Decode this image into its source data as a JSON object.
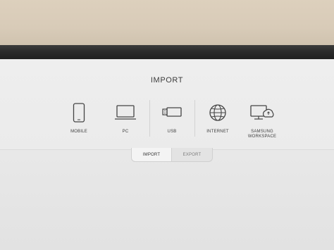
{
  "header": {
    "title": "IMPORT"
  },
  "options": [
    {
      "label": "MOBILE",
      "icon": "mobile-icon"
    },
    {
      "label": "PC",
      "icon": "laptop-icon"
    },
    {
      "label": "USB",
      "icon": "usb-icon"
    },
    {
      "label": "INTERNET",
      "icon": "globe-icon"
    },
    {
      "label": "SAMSUNG\nWORKSPACE",
      "icon": "workspace-icon"
    }
  ],
  "tabs": [
    {
      "label": "IMPORT",
      "selected": true
    },
    {
      "label": "EXPORT",
      "selected": false
    }
  ],
  "colors": {
    "screen": "#ebebeb",
    "bezel": "#2a2a2a",
    "wall": "#d8cbb8",
    "icon": "#444444"
  }
}
